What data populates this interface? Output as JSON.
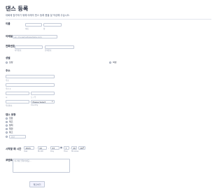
{
  "form": {
    "title": "댄스 등록",
    "subtitle": "대회에 참가하기 위해 아래의 댄스 등록 폼을 잘 작성해 주십시오."
  },
  "name": {
    "label": "이름",
    "first_sub": "이름",
    "last_sub": "성"
  },
  "email": {
    "label": "이메일",
    "placeholder": "ex: myname@example.com"
  },
  "phone": {
    "label": "전화번호",
    "area_sub": "지역번호",
    "number_sub": "전화번호"
  },
  "gender": {
    "label": "성별",
    "options": [
      "남성",
      "여성"
    ]
  },
  "address": {
    "label": "주소",
    "street1_sub": "주소",
    "street2_sub": "주소 2",
    "city_sub": "시",
    "state_sub": "도 / 주",
    "postal_sub": "우편번호",
    "country_value": "Please Select",
    "country_sub": "Country"
  },
  "dance": {
    "label": "댄스 유형",
    "options": [
      "힙합",
      "재즈",
      "발레",
      "탭댄",
      "탱고"
    ],
    "other_placeholder": "기타"
  },
  "datetime": {
    "label": "시작할 때 시간",
    "year": "2024",
    "month": "02",
    "day": "03",
    "hour": "7",
    "minute": "20",
    "ampm": "AM",
    "year_sub": "Year",
    "month_sub": "Month",
    "day_sub": "Day",
    "hour_sub": "Hour",
    "minute_sub": "Minutes"
  },
  "comments": {
    "label": "코멘트",
    "placeholder": "여기에 입력하세요..."
  },
  "submit": {
    "label": "제출하기"
  }
}
